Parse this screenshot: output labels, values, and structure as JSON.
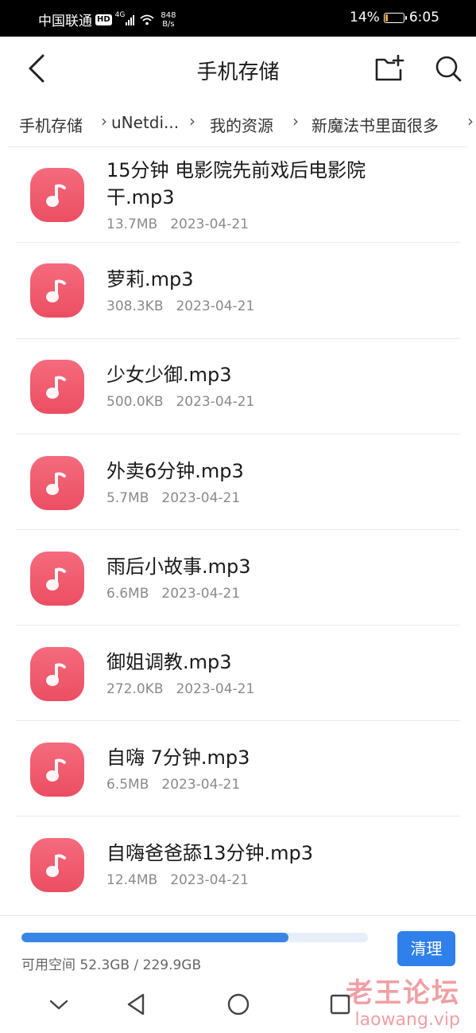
{
  "status_bar": {
    "carrier": "中国联通",
    "hd_badge": "HD",
    "network_type": "4G",
    "speed_value": "848",
    "speed_unit": "B/s",
    "battery_percent": "14%",
    "battery_level": 0.14,
    "time": "6:05",
    "battery_color": "#f5a623"
  },
  "app_bar": {
    "title": "手机存储",
    "back_icon": "chevron-left-icon",
    "new_folder_icon": "new-folder-icon",
    "search_icon": "search-icon"
  },
  "breadcrumb": {
    "items": [
      "手机存储",
      "uNetdi...",
      "我的资源",
      "新魔法书里面很多"
    ],
    "separator": "›"
  },
  "files": [
    {
      "name_line1": "15分钟 电影院先前戏后电影院",
      "name_line2": "干.mp3",
      "size": "13.7MB",
      "date": "2023-04-21",
      "icon": "music-note-icon"
    },
    {
      "name_line1": "萝莉.mp3",
      "name_line2": "",
      "size": "308.3KB",
      "date": "2023-04-21",
      "icon": "music-note-icon"
    },
    {
      "name_line1": "少女少御.mp3",
      "name_line2": "",
      "size": "500.0KB",
      "date": "2023-04-21",
      "icon": "music-note-icon"
    },
    {
      "name_line1": "外卖6分钟.mp3",
      "name_line2": "",
      "size": "5.7MB",
      "date": "2023-04-21",
      "icon": "music-note-icon"
    },
    {
      "name_line1": "雨后小故事.mp3",
      "name_line2": "",
      "size": "6.6MB",
      "date": "2023-04-21",
      "icon": "music-note-icon"
    },
    {
      "name_line1": "御姐调教.mp3",
      "name_line2": "",
      "size": "272.0KB",
      "date": "2023-04-21",
      "icon": "music-note-icon"
    },
    {
      "name_line1": "自嗨 7分钟.mp3",
      "name_line2": "",
      "size": "6.5MB",
      "date": "2023-04-21",
      "icon": "music-note-icon"
    },
    {
      "name_line1": "自嗨爸爸舔13分钟.mp3",
      "name_line2": "",
      "size": "12.4MB",
      "date": "2023-04-21",
      "icon": "music-note-icon"
    }
  ],
  "storage": {
    "text": "可用空间 52.3GB / 229.9GB",
    "used_fraction": 0.77,
    "clean_label": "清理",
    "accent_color": "#2f80ea"
  },
  "nav_bar": {
    "icons": [
      "chevron-down-icon",
      "back-triangle-icon",
      "home-circle-icon",
      "recents-square-icon"
    ]
  },
  "watermark": {
    "line1": "老王论坛",
    "line2": "laowang.vip"
  }
}
